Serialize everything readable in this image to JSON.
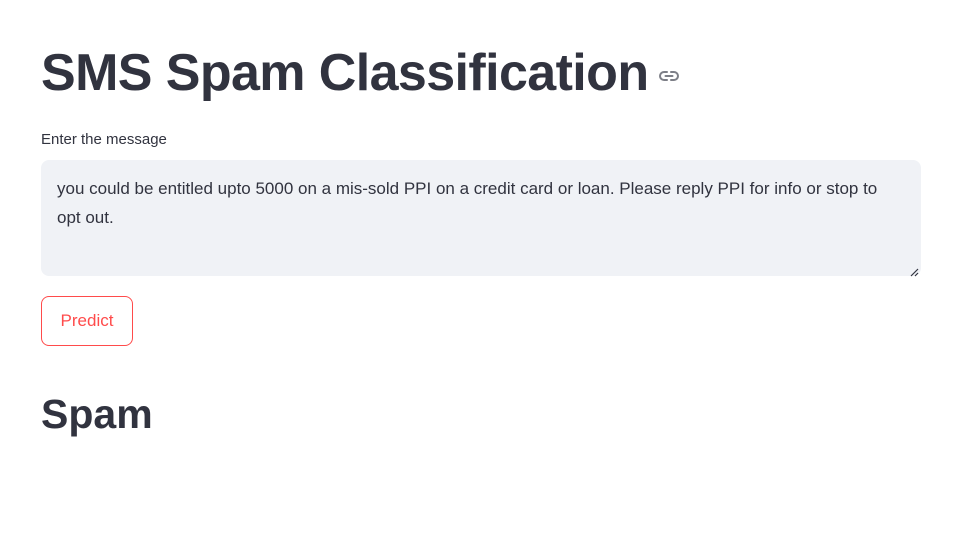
{
  "header": {
    "title": "SMS Spam Classification",
    "anchor_icon": "link-icon"
  },
  "form": {
    "label": "Enter the message",
    "message_value": "you could be entitled upto 5000 on a mis-sold PPI on a credit card or loan. Please reply PPI for info or stop to opt out.",
    "predict_label": "Predict"
  },
  "result": {
    "text": "Spam"
  },
  "colors": {
    "text": "#31333f",
    "accent": "#ff4b4b",
    "input_bg": "#f0f2f6"
  }
}
